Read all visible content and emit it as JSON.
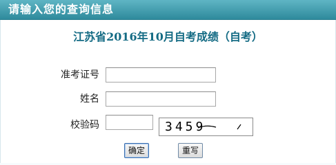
{
  "header": {
    "title": "请输入您的查询信息"
  },
  "form": {
    "title": "江苏省2016年10月自考成绩（自考）",
    "fields": {
      "exam_no_label": "准考证号",
      "name_label": "姓名",
      "verify_label": "校验码"
    },
    "captcha_text": "3459",
    "buttons": {
      "confirm": "确定",
      "reset": "重写"
    }
  }
}
